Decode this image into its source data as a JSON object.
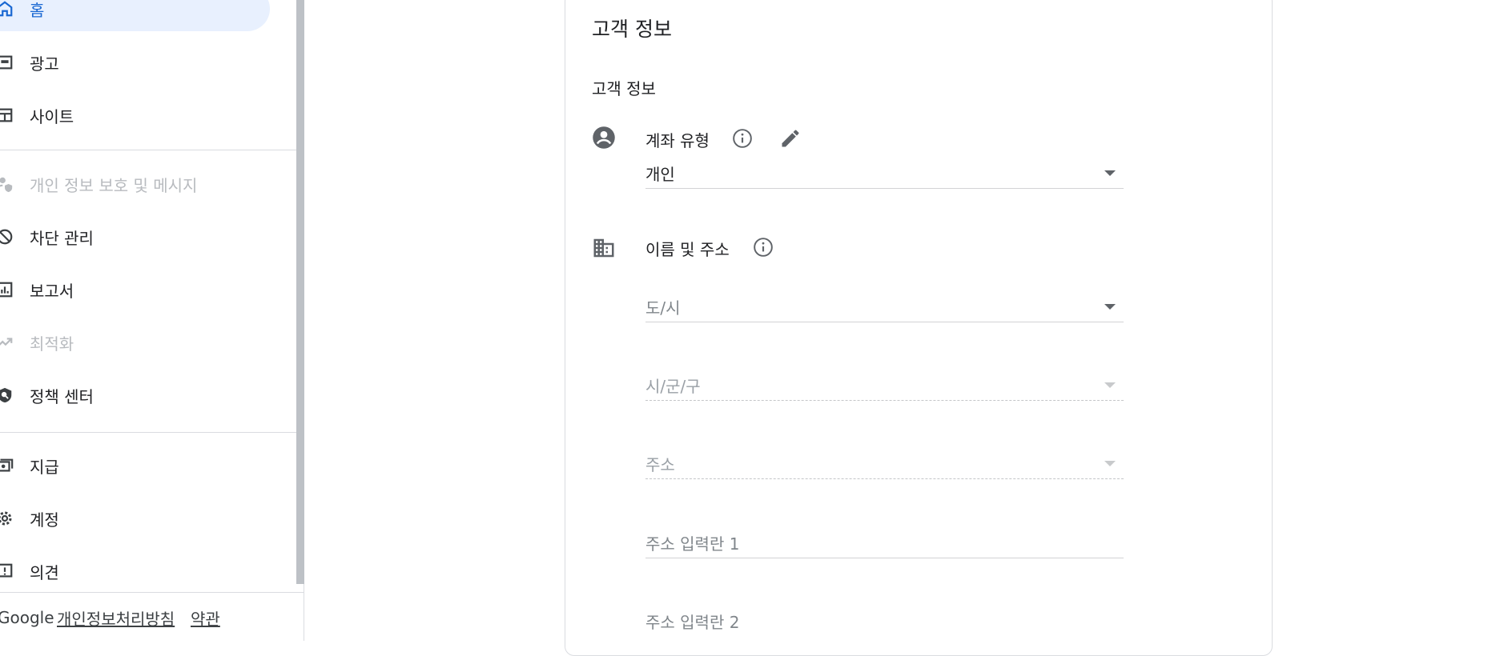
{
  "sidebar": {
    "items": [
      {
        "label": "홈",
        "icon": "home-icon",
        "state": "active"
      },
      {
        "label": "광고",
        "icon": "ads-icon",
        "state": "normal"
      },
      {
        "label": "사이트",
        "icon": "sites-icon",
        "state": "normal"
      },
      {
        "label": "개인 정보 보호 및 메시지",
        "icon": "privacy-icon",
        "state": "disabled"
      },
      {
        "label": "차단 관리",
        "icon": "block-icon",
        "state": "normal"
      },
      {
        "label": "보고서",
        "icon": "reports-icon",
        "state": "normal"
      },
      {
        "label": "최적화",
        "icon": "optimization-icon",
        "state": "disabled"
      },
      {
        "label": "정책 센터",
        "icon": "policy-icon",
        "state": "normal"
      },
      {
        "label": "지급",
        "icon": "payments-icon",
        "state": "normal"
      },
      {
        "label": "계정",
        "icon": "gear-icon",
        "state": "normal"
      },
      {
        "label": "의견",
        "icon": "feedback-icon",
        "state": "normal"
      }
    ],
    "footer": {
      "brand": "Google",
      "privacy_link": "개인정보처리방침",
      "terms_link": "약관"
    }
  },
  "card": {
    "title": "고객 정보",
    "section_title": "고객 정보",
    "account_type": {
      "label": "계좌 유형",
      "value": "개인"
    },
    "name_address": {
      "label": "이름 및 주소",
      "fields": {
        "province": "도/시",
        "city": "시/군/구",
        "address": "주소",
        "address_line1": "주소 입력란 1",
        "address_line2": "주소 입력란 2"
      }
    }
  },
  "colors": {
    "accent": "#1967d2",
    "active_bg": "#e8f0fe",
    "divider": "#dadce0"
  }
}
